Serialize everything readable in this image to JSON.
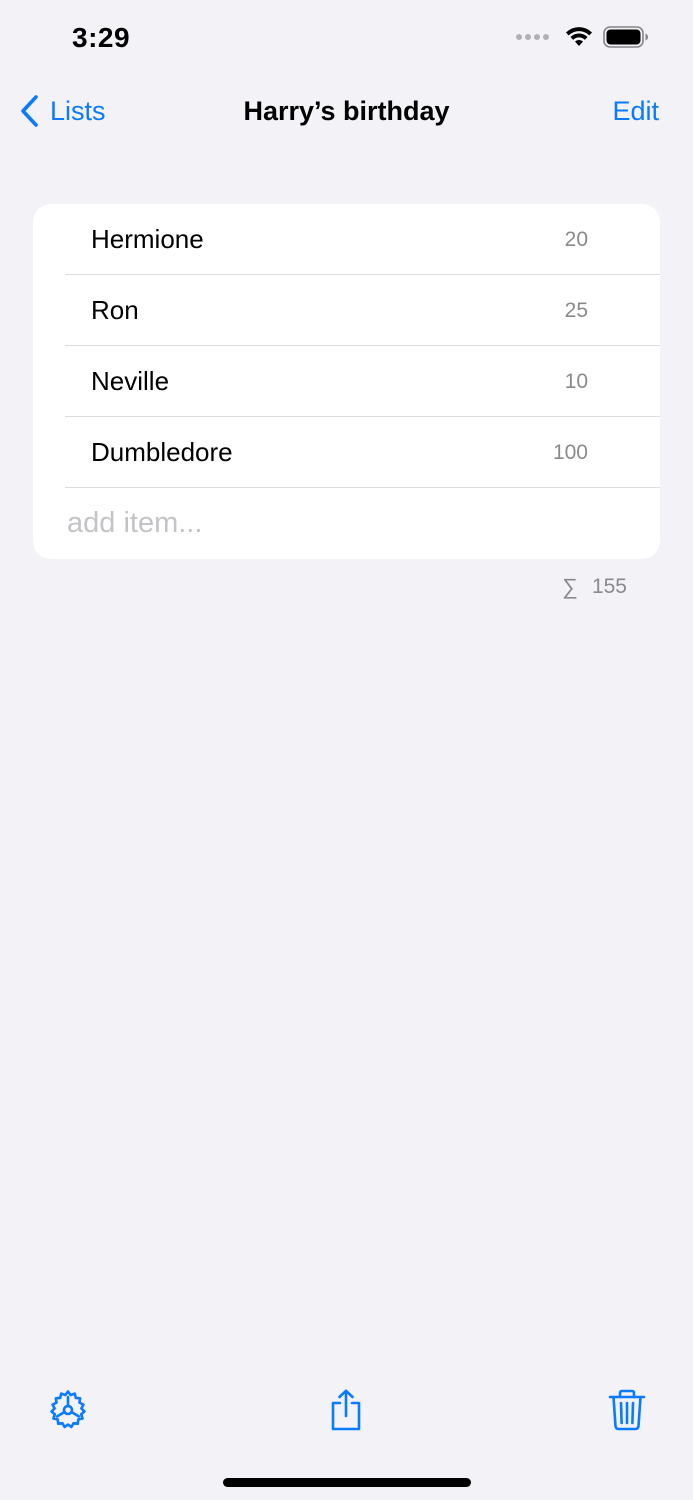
{
  "status_bar": {
    "time": "3:29"
  },
  "nav": {
    "back_label": "Lists",
    "title": "Harry’s birthday",
    "edit_label": "Edit"
  },
  "list": {
    "items": [
      {
        "name": "Hermione",
        "value": "20"
      },
      {
        "name": "Ron",
        "value": "25"
      },
      {
        "name": "Neville",
        "value": "10"
      },
      {
        "name": "Dumbledore",
        "value": "100"
      }
    ],
    "add_placeholder": "add item..."
  },
  "summary": {
    "symbol": "∑",
    "total": "155"
  },
  "toolbar": {
    "icons": [
      "settings-icon",
      "share-icon",
      "trash-icon"
    ]
  },
  "colors": {
    "accent": "#0a7aff",
    "background": "#f2f2f7",
    "card": "#ffffff",
    "secondary_text": "#8a8a8e",
    "placeholder": "#c4c4c8"
  }
}
